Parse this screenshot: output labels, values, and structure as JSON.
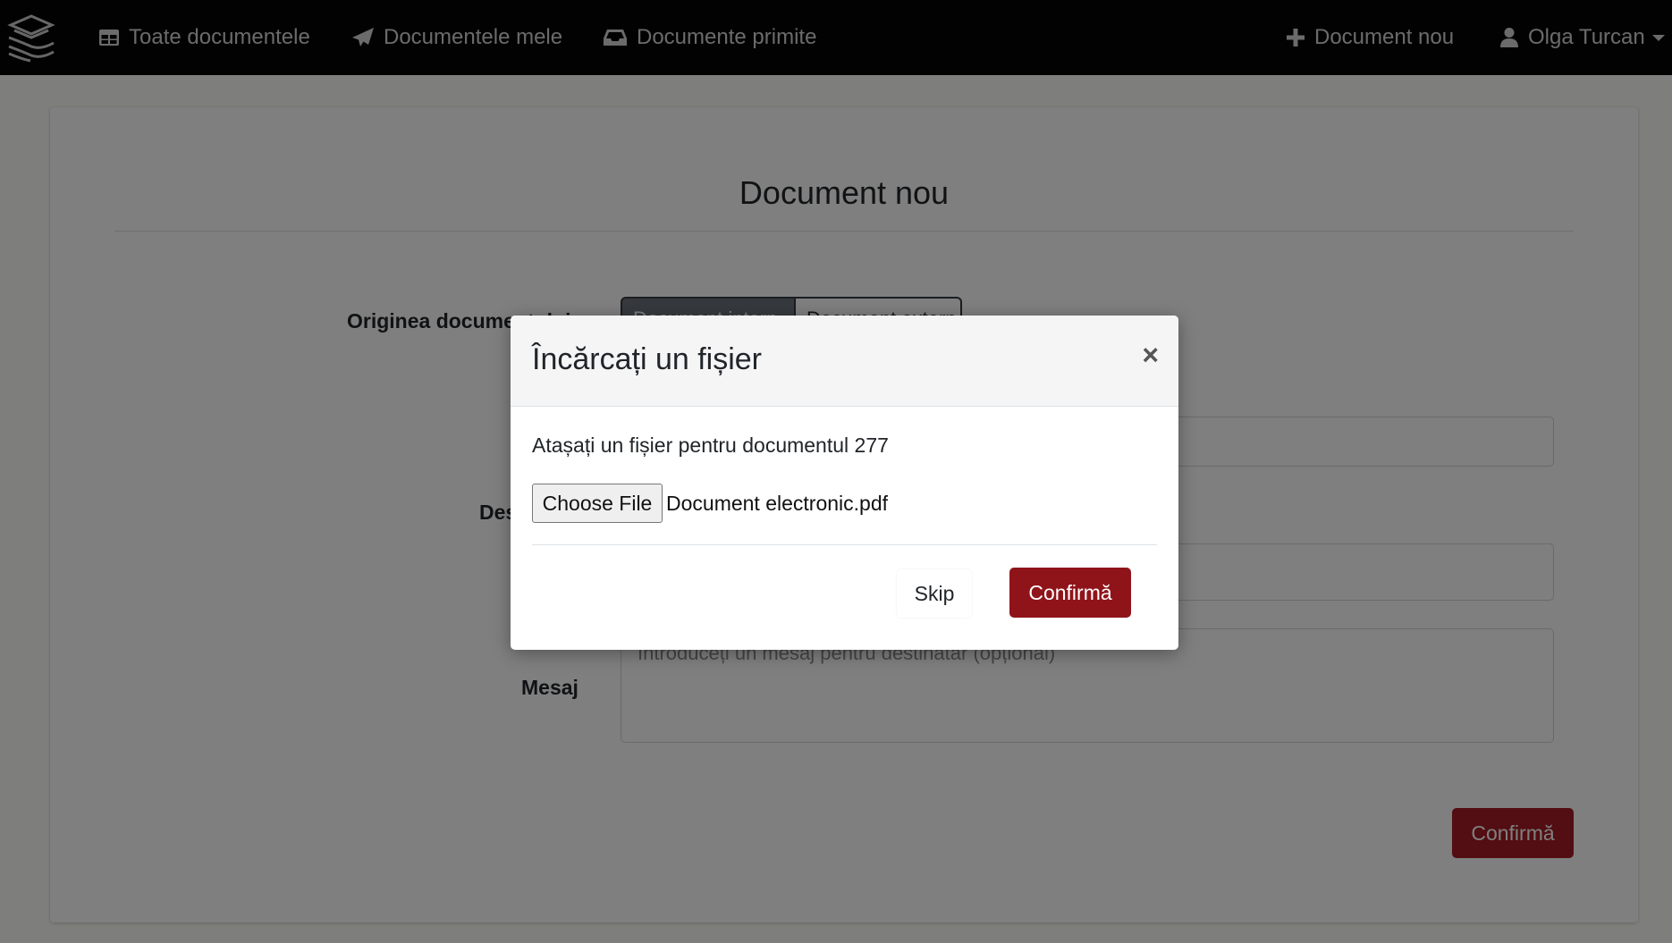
{
  "navbar": {
    "items": [
      {
        "label": "Toate documentele",
        "icon": "table-icon"
      },
      {
        "label": "Documentele mele",
        "icon": "paper-plane-icon"
      },
      {
        "label": "Documente primite",
        "icon": "inbox-icon"
      }
    ],
    "new_document": "Document nou",
    "user": "Olga Turcan"
  },
  "page": {
    "title": "Document nou",
    "origin_label": "Originea documentului",
    "origin_options": [
      "Document intern",
      "Document extern"
    ],
    "destination_label": "Destinatar",
    "message_label": "Mesaj",
    "message_placeholder": "Introduceți un mesaj pentru destinatar (opțional)",
    "confirm_button": "Confirmă"
  },
  "modal": {
    "title": "Încărcați un fișier",
    "close": "×",
    "text": "Atașați un fișier pentru documentul 277",
    "choose_file": "Choose File",
    "file_name": "Document electronic.pdf",
    "skip": "Skip",
    "confirm": "Confirmă"
  },
  "colors": {
    "navbar": "#050505",
    "primary": "#a51d24",
    "backdrop": "rgba(0,0,0,0.5)"
  }
}
